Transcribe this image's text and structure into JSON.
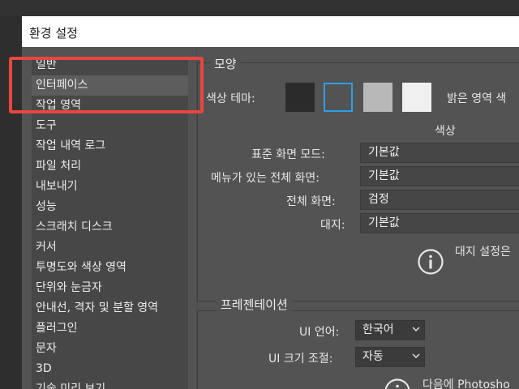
{
  "window": {
    "title": "환경 설정"
  },
  "sidebar": {
    "items": [
      {
        "label": "일반"
      },
      {
        "label": "인터페이스"
      },
      {
        "label": "작업 영역"
      },
      {
        "label": "도구"
      },
      {
        "label": "작업 내역 로그"
      },
      {
        "label": "파일 처리"
      },
      {
        "label": "내보내기"
      },
      {
        "label": "성능"
      },
      {
        "label": "스크래치 디스크"
      },
      {
        "label": "커서"
      },
      {
        "label": "투명도와 색상 영역"
      },
      {
        "label": "단위와 눈금자"
      },
      {
        "label": "안내선, 격자 및 분할 영역"
      },
      {
        "label": "플러그인"
      },
      {
        "label": "문자"
      },
      {
        "label": "3D"
      },
      {
        "label": "기술 미리 보기"
      }
    ],
    "selected_index": 1
  },
  "appearance": {
    "title": "모양",
    "theme_label": "색상 테마:",
    "highlight_label": "밝은 영역 색",
    "swatch_colors": [
      "#2b2b2b",
      "#535353",
      "#b8b8b8",
      "#f0f0f0"
    ],
    "selected_theme_index": 1,
    "selected_border_color": "#2aa0e8",
    "color_header": "색상",
    "rows": [
      {
        "label": "표준 화면 모드:",
        "value": "기본값"
      },
      {
        "label": "메뉴가 있는 전체 화면:",
        "value": "기본값"
      },
      {
        "label": "전체 화면:",
        "value": "검정"
      },
      {
        "label": "대지:",
        "value": "기본값"
      }
    ],
    "artboard_note": "대지 설정은"
  },
  "presentation": {
    "title": "프레젠테이션",
    "ui_language_label": "UI 언어:",
    "ui_language_value": "한국어",
    "ui_scale_label": "UI 크기 조절:",
    "ui_scale_value": "자동",
    "note": "다음에 Photosho"
  },
  "colors": {
    "highlight_frame": "#e8463f",
    "accent": "#2aa0e8"
  }
}
